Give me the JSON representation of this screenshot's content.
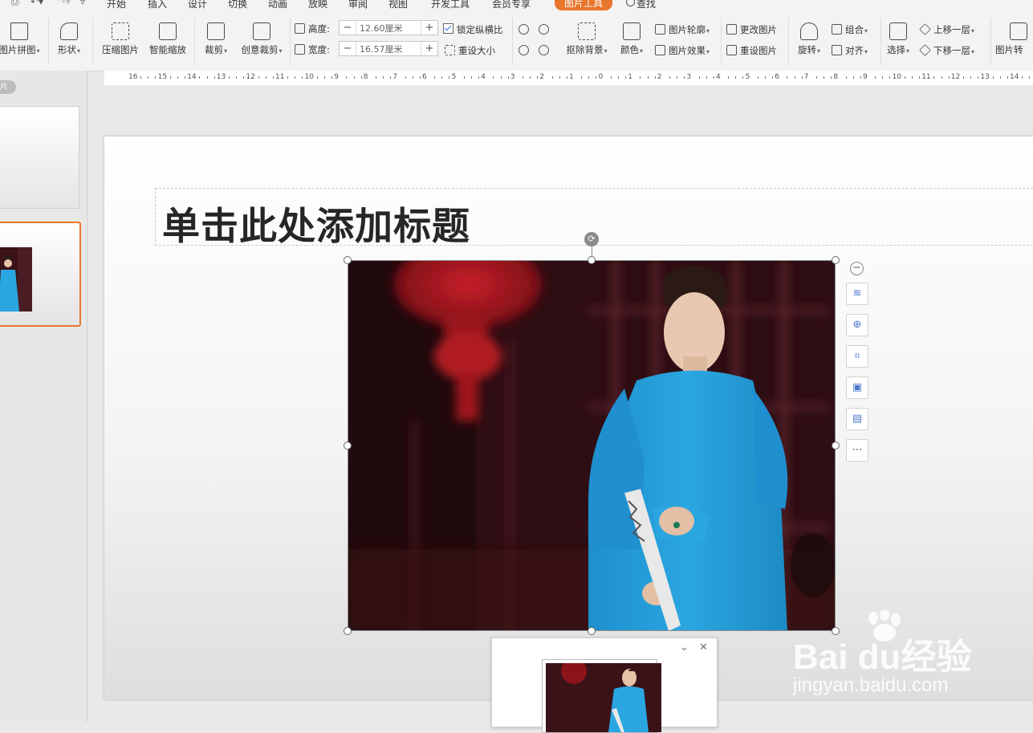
{
  "menu": {
    "tabs": [
      "开始",
      "插入",
      "设计",
      "切换",
      "动画",
      "放映",
      "审阅",
      "视图",
      "开发工具",
      "会员专享"
    ],
    "active_tab": "图片工具",
    "search_label": "查找"
  },
  "ribbon": {
    "picture_collage": "图片拼图",
    "shape": "形状",
    "compress": "压缩图片",
    "smart_zoom": "智能缩放",
    "crop": "裁剪",
    "creative_crop": "创意裁剪",
    "height_label": "高度:",
    "height_value": "12.60厘米",
    "width_label": "宽度:",
    "width_value": "16.57厘米",
    "lock_ratio": "锁定纵横比",
    "reset_size": "重设大小",
    "remove_bg": "抠除背景",
    "color": "颜色",
    "outline": "图片轮廓",
    "effects": "图片效果",
    "change_picture": "更改图片",
    "reset_picture": "重设图片",
    "rotate": "旋转",
    "group": "组合",
    "align": "对齐",
    "select": "选择",
    "bring_forward": "上移一层",
    "send_backward": "下移一层",
    "picture_convert": "图片转"
  },
  "leftpane": {
    "label": "片"
  },
  "ruler": {
    "labels": [
      "16",
      "15",
      "14",
      "13",
      "12",
      "11",
      "10",
      "9",
      "8",
      "7",
      "6",
      "5",
      "4",
      "3",
      "2",
      "1",
      "0",
      "1",
      "2",
      "3",
      "4",
      "5",
      "6",
      "7",
      "8",
      "9",
      "10",
      "11",
      "12",
      "13",
      "14"
    ]
  },
  "slide": {
    "title_placeholder": "单击此处添加标题"
  },
  "watermark": {
    "logo": "Bai du经验",
    "url": "jingyan.baidu.com"
  },
  "colors": {
    "accent": "#e8762d",
    "robe": "#2aa6e0"
  }
}
